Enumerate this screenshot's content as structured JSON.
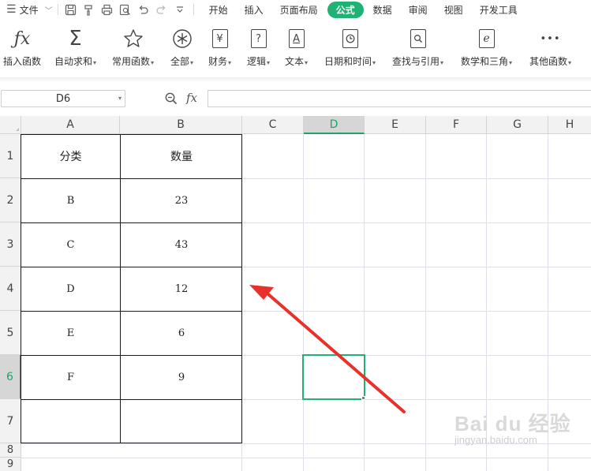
{
  "menubar": {
    "file_label": "文件",
    "quick_access_icons": [
      "save-icon",
      "format-painter-icon",
      "print-icon",
      "print-preview-icon",
      "undo-icon",
      "redo-icon",
      "customize-dropdown-icon"
    ],
    "tabs": [
      {
        "label": "开始",
        "active": false
      },
      {
        "label": "插入",
        "active": false
      },
      {
        "label": "页面布局",
        "active": false
      },
      {
        "label": "公式",
        "active": true
      },
      {
        "label": "数据",
        "active": false
      },
      {
        "label": "审阅",
        "active": false
      },
      {
        "label": "视图",
        "active": false
      },
      {
        "label": "开发工具",
        "active": false
      }
    ]
  },
  "ribbon": {
    "insert_function": "插入函数",
    "autosum": "自动求和",
    "common": "常用函数",
    "all": "全部",
    "finance": "财务",
    "logic": "逻辑",
    "text": "文本",
    "datetime": "日期和时间",
    "lookup": "查找与引用",
    "math": "数学和三角",
    "other": "其他函数",
    "finance_glyph": "¥",
    "logic_glyph": "?",
    "text_glyph": "A",
    "math_glyph": "e",
    "other_glyph": "•••"
  },
  "formula_bar": {
    "name_box": "D6",
    "fx": "fx",
    "formula": ""
  },
  "sheet": {
    "columns": [
      "A",
      "B",
      "C",
      "D",
      "E",
      "F",
      "G",
      "H"
    ],
    "rows": [
      "1",
      "2",
      "3",
      "4",
      "5",
      "6",
      "7",
      "8",
      "9"
    ],
    "selected_column": "D",
    "selected_row": "6",
    "table": [
      {
        "category": "分类",
        "count": "数量"
      },
      {
        "category": "B",
        "count": "23"
      },
      {
        "category": "C",
        "count": "43"
      },
      {
        "category": "D",
        "count": "12"
      },
      {
        "category": "E",
        "count": "6"
      },
      {
        "category": "F",
        "count": "9"
      },
      {
        "category": "",
        "count": ""
      }
    ]
  },
  "watermark": {
    "brand": "Bai du 经验",
    "url": "jingyan.baidu.com"
  },
  "colors": {
    "accent": "#1fb274",
    "annotation_arrow": "#e8312d"
  }
}
